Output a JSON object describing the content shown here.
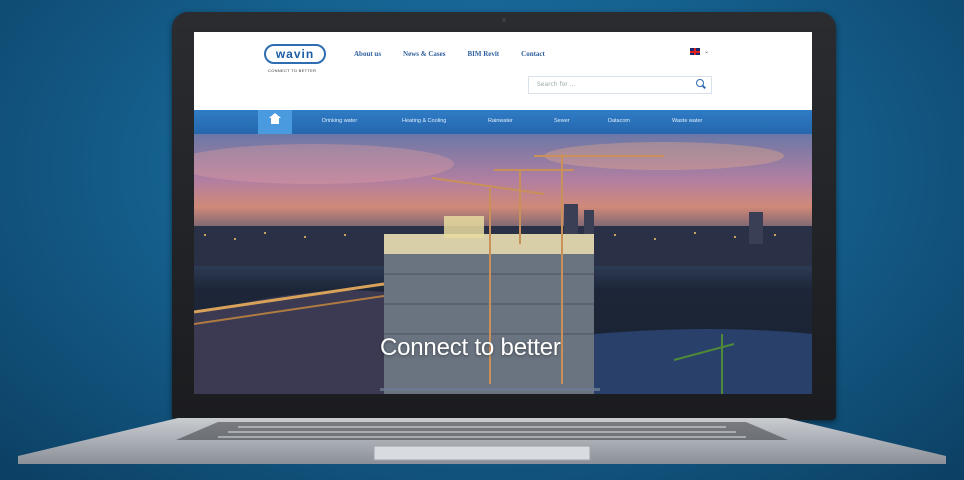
{
  "header": {
    "logo_text": "wavin",
    "tagline": "CONNECT TO BETTER",
    "nav": [
      "About us",
      "News & Cases",
      "BIM Revit",
      "Contact"
    ],
    "search_placeholder": "Search for ..."
  },
  "mainnav": {
    "items": [
      "Drinking water",
      "Heating & Cooling",
      "Rainwater",
      "Sewer",
      "Datacom",
      "Waste water"
    ]
  },
  "hero": {
    "headline": "Connect to better"
  },
  "colors": {
    "brand_blue": "#2e6db0",
    "nav_bar": "#2567ad",
    "home_tab": "#4a9ae0"
  }
}
